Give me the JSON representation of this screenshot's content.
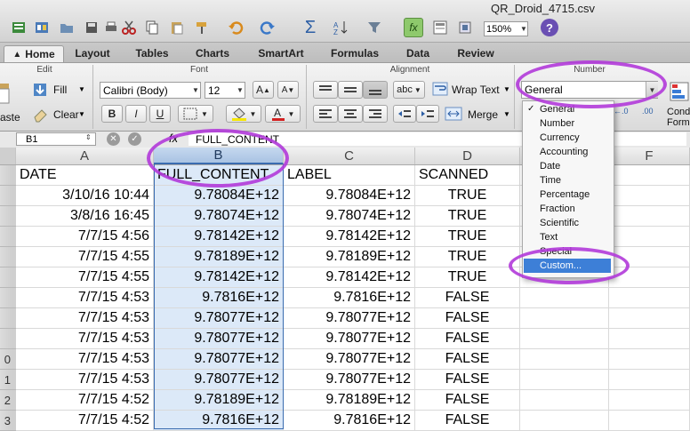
{
  "window": {
    "title": "QR_Droid_4715.csv"
  },
  "toolbar": {
    "zoom_value": "150%"
  },
  "tabs": [
    "Home",
    "Layout",
    "Tables",
    "Charts",
    "SmartArt",
    "Formulas",
    "Data",
    "Review"
  ],
  "ribbon": {
    "groups": {
      "edit": "Edit",
      "font": "Font",
      "alignment": "Alignment",
      "number": "Number"
    },
    "paste_label": "aste",
    "fill_label": "Fill",
    "clear_label": "Clear",
    "font_name": "Calibri (Body)",
    "font_size": "12",
    "bold": "B",
    "italic": "I",
    "underline": "U",
    "increase_font": "A",
    "decrease_font": "A",
    "abc_label": "abc",
    "wrap_text_label": "Wrap Text",
    "merge_label": "Merge",
    "number_format_value": "General",
    "cond_label_1": "Cond",
    "cond_label_2": "Form"
  },
  "formula_bar": {
    "cell_ref": "B1",
    "fx_label": "fx",
    "content": "FULL_CONTENT"
  },
  "sheet": {
    "columns": [
      "A",
      "B",
      "C",
      "D",
      "E",
      "F"
    ],
    "row_numbers": [
      "",
      "",
      "",
      "",
      "",
      "",
      "",
      "",
      "",
      "0",
      "1",
      "2",
      "3"
    ],
    "rows": [
      [
        "DATE",
        "FULL_CONTENT",
        "LABEL",
        "SCANNED"
      ],
      [
        "3/10/16 10:44",
        "9.78084E+12",
        "9.78084E+12",
        "TRUE"
      ],
      [
        "3/8/16 16:45",
        "9.78074E+12",
        "9.78074E+12",
        "TRUE"
      ],
      [
        "7/7/15 4:56",
        "9.78142E+12",
        "9.78142E+12",
        "TRUE"
      ],
      [
        "7/7/15 4:55",
        "9.78189E+12",
        "9.78189E+12",
        "TRUE"
      ],
      [
        "7/7/15 4:55",
        "9.78142E+12",
        "9.78142E+12",
        "TRUE"
      ],
      [
        "7/7/15 4:53",
        "9.7816E+12",
        "9.7816E+12",
        "FALSE"
      ],
      [
        "7/7/15 4:53",
        "9.78077E+12",
        "9.78077E+12",
        "FALSE"
      ],
      [
        "7/7/15 4:53",
        "9.78077E+12",
        "9.78077E+12",
        "FALSE"
      ],
      [
        "7/7/15 4:53",
        "9.78077E+12",
        "9.78077E+12",
        "FALSE"
      ],
      [
        "7/7/15 4:53",
        "9.78077E+12",
        "9.78077E+12",
        "FALSE"
      ],
      [
        "7/7/15 4:52",
        "9.78189E+12",
        "9.78189E+12",
        "FALSE"
      ],
      [
        "7/7/15 4:52",
        "9.7816E+12",
        "9.7816E+12",
        "FALSE"
      ]
    ]
  },
  "number_format_menu": {
    "checkmark": "✓",
    "items": [
      "General",
      "Number",
      "Currency",
      "Accounting",
      "Date",
      "Time",
      "Percentage",
      "Fraction",
      "Scientific",
      "Text",
      "Special",
      "Custom..."
    ],
    "selected": "General",
    "highlighted": "Custom..."
  },
  "accent_colors": {
    "highlight_oval": "#b13ad9",
    "menu_highlight": "#3d7fd7",
    "selected_column": "#dce9f8"
  }
}
